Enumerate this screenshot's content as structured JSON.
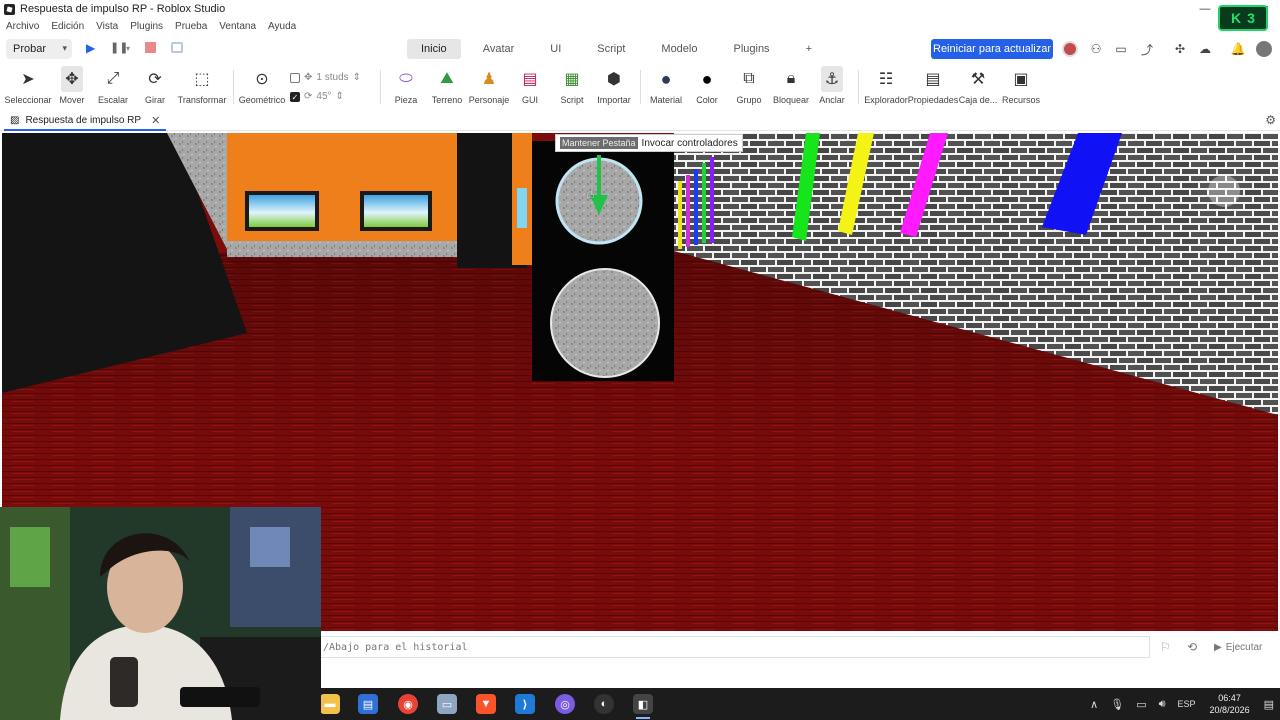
{
  "window": {
    "title": "Respuesta de impulso RP - Roblox Studio",
    "controls": [
      "—",
      "□",
      "✕"
    ]
  },
  "badge": {
    "k": "K",
    "level": "3"
  },
  "menu": [
    "Archivo",
    "Edición",
    "Vista",
    "Plugins",
    "Prueba",
    "Ventana",
    "Ayuda"
  ],
  "play_select": {
    "value": "Probar"
  },
  "tabs": [
    {
      "label": "Inicio",
      "active": true
    },
    {
      "label": "Avatar"
    },
    {
      "label": "UI"
    },
    {
      "label": "Script"
    },
    {
      "label": "Modelo"
    },
    {
      "label": "Plugins"
    },
    {
      "label": "+"
    }
  ],
  "update_button": "Reiniciar para actualizar",
  "tools": {
    "select": "Seleccionar",
    "move": "Mover",
    "scale": "Escalar",
    "rotate": "Girar",
    "transform": "Transformar",
    "geometric": "Geométrico",
    "studs": "1 studs",
    "degrees": "45°",
    "part": "Pieza",
    "terrain": "Terreno",
    "character": "Personaje",
    "gui": "GUI",
    "script": "Script",
    "import": "Importar",
    "material": "Material",
    "color": "Color",
    "group": "Grupo",
    "lock": "Bloquear",
    "anchor": "Anclar",
    "explorer": "Explorador",
    "properties": "Propiedades",
    "toolbox": "Caja de...",
    "resources": "Recursos"
  },
  "doc_tab": {
    "label": "Respuesta de impulso RP"
  },
  "tooltip": {
    "key": "Mantener Pestaña",
    "text": "Invocar controladores"
  },
  "command_bar": {
    "placeholder": "/Abajo para el historial",
    "run": "Ejecutar"
  },
  "tray": {
    "lang": "ESP",
    "time": "06:47",
    "date": "20/8/2026"
  },
  "colors": {
    "accent": "#2561e8",
    "floor": "#7b0c0c",
    "wall_orange": "#ef7f1a",
    "taskbar": "#1c1c1c"
  }
}
